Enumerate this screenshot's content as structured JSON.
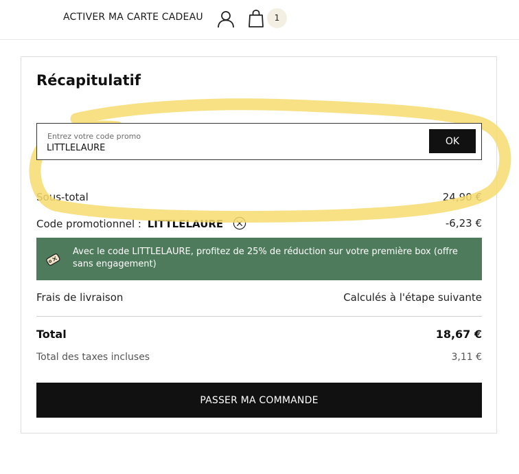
{
  "header": {
    "gift_card_link": "ACTIVER MA CARTE CADEAU",
    "cart_count": "1",
    "icons": [
      "user-icon",
      "shopping-bag-icon"
    ]
  },
  "summary": {
    "title": "Récapitulatif",
    "promo": {
      "label": "Entrez votre code promo",
      "value": "LITTLELAURE",
      "apply_label": "OK",
      "highlight_color": "#f7dc6f"
    },
    "subtotal": {
      "label": "Sous-total",
      "value": "24,90 €"
    },
    "discount": {
      "label": "Code promotionnel :",
      "code": "LITTLELAURE",
      "value": "-6,23 €",
      "remove_icon": "close-circle-icon"
    },
    "banner": {
      "text": "Avec le code LITTLELAURE, profitez de 25% de réduction sur votre première box (offre sans engagement)",
      "icon": "gift-tag-icon",
      "color": "#4e7b5b"
    },
    "shipping": {
      "label": "Frais de livraison",
      "value": "Calculés à l'étape suivante"
    },
    "total": {
      "label": "Total",
      "value": "18,67 €"
    },
    "taxes": {
      "label": "Total des taxes incluses",
      "value": "3,11 €"
    },
    "checkout_label": "PASSER MA COMMANDE"
  }
}
